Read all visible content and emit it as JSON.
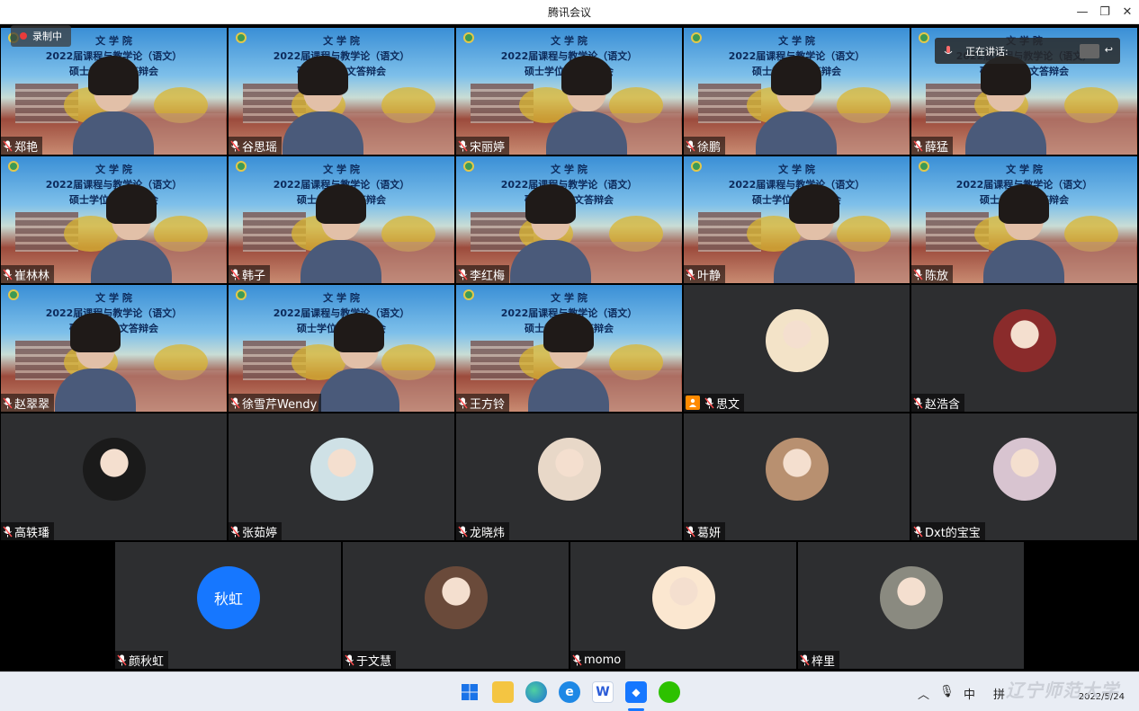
{
  "window": {
    "title": "腾讯会议"
  },
  "recording": {
    "label": "录制中"
  },
  "speaking": {
    "label": "正在讲话:"
  },
  "banner": {
    "line1": "文 学 院",
    "line2": "2022届课程与教学论（语文）",
    "line3": "硕士学位论文答辩会"
  },
  "participants": [
    {
      "name": "郑艳",
      "video": true
    },
    {
      "name": "谷思瑶",
      "video": true
    },
    {
      "name": "宋丽婷",
      "video": true
    },
    {
      "name": "徐鹏",
      "video": true
    },
    {
      "name": "薛猛",
      "video": true
    },
    {
      "name": "崔林林",
      "video": true
    },
    {
      "name": "韩子",
      "video": true
    },
    {
      "name": "李红梅",
      "video": true
    },
    {
      "name": "叶静",
      "video": true
    },
    {
      "name": "陈放",
      "video": true
    },
    {
      "name": "赵翠翠",
      "video": true
    },
    {
      "name": "徐雪芹Wendy",
      "video": true
    },
    {
      "name": "王方铃",
      "video": true
    },
    {
      "name": "思文",
      "video": false,
      "host_badge": true
    },
    {
      "name": "赵浩含",
      "video": false
    },
    {
      "name": "高轶璠",
      "video": false
    },
    {
      "name": "张茹婷",
      "video": false
    },
    {
      "name": "龙晓炜",
      "video": false
    },
    {
      "name": "葛妍",
      "video": false
    },
    {
      "name": "Dxt的宝宝",
      "video": false
    },
    {
      "name": "颜秋虹",
      "video": false,
      "avatar_text": "秋虹"
    },
    {
      "name": "于文慧",
      "video": false
    },
    {
      "name": "momo",
      "video": false
    },
    {
      "name": "梓里",
      "video": false
    }
  ],
  "taskbar": {
    "input_method": "中",
    "input_mode": "拼",
    "date": "2022/5/24"
  },
  "watermark": "辽宁师范大学"
}
